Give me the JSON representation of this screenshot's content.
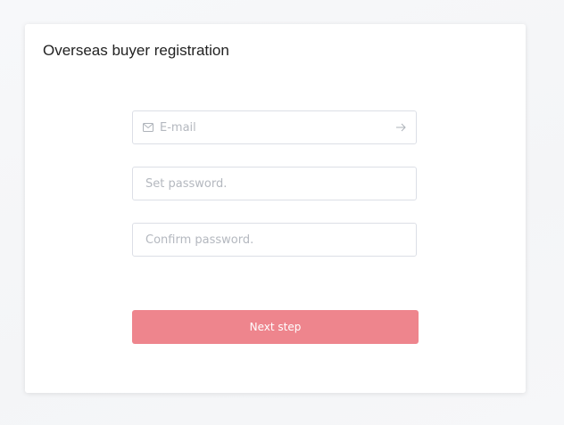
{
  "page": {
    "title": "Overseas buyer registration"
  },
  "form": {
    "email": {
      "value": "",
      "placeholder": "E-mail",
      "icon": "mail-icon",
      "action_icon": "arrow-right-icon"
    },
    "password": {
      "value": "",
      "placeholder": "Set password."
    },
    "confirm_password": {
      "value": "",
      "placeholder": "Confirm password."
    },
    "next_button_label": "Next step"
  },
  "colors": {
    "button": "#ee858d",
    "border": "#dcdfe6",
    "placeholder": "#b4b8bf",
    "background": "#f5f6f8"
  }
}
